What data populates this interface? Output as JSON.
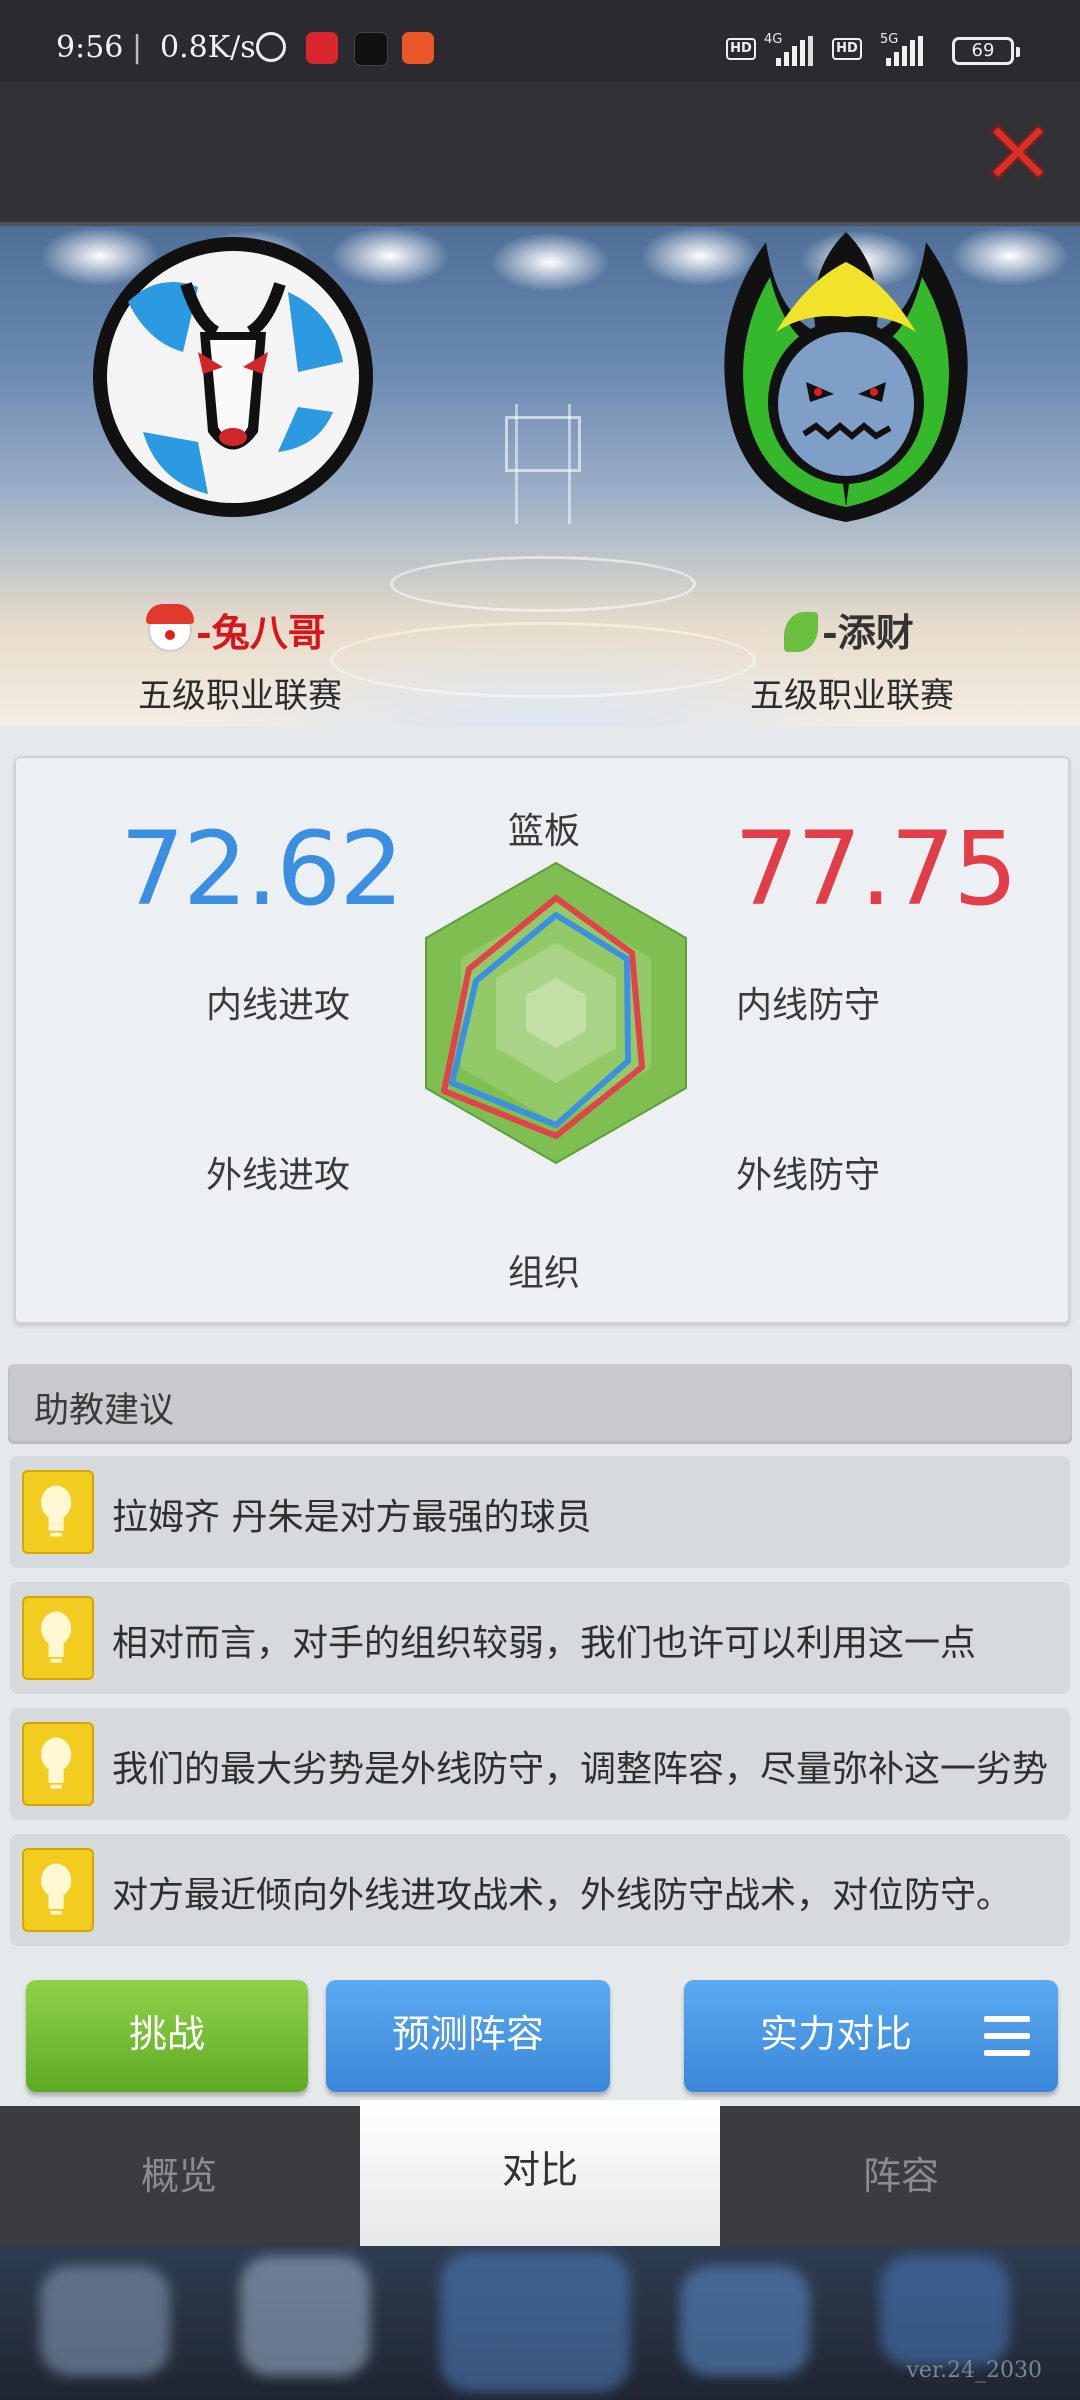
{
  "status_bar": {
    "time": "9:56",
    "separator": "|",
    "net_speed": "0.8K/s",
    "network_1": "4G",
    "network_2": "5G",
    "battery": "69"
  },
  "home_team": {
    "name": "-兔八哥",
    "league": "五级职业联赛",
    "score": "72.62",
    "color": "#3b8fe0"
  },
  "away_team": {
    "name": "-添财",
    "league": "五级职业联赛",
    "score": "77.75",
    "color": "#e23e49"
  },
  "radar": {
    "axes": [
      "篮板",
      "内线防守",
      "外线防守",
      "组织",
      "外线进攻",
      "内线进攻"
    ]
  },
  "advice": {
    "title": "助教建议",
    "items": [
      "拉姆齐 丹朱是对方最强的球员",
      "相对而言，对手的组织较弱，我们也许可以利用这一点",
      "我们的最大劣势是外线防守，调整阵容，尽量弥补这一劣势",
      "对方最近倾向外线进攻战术，外线防守战术，对位防守。"
    ]
  },
  "buttons": {
    "challenge": "挑战",
    "predict_lineup": "预测阵容",
    "strength_compare": "实力对比"
  },
  "tabs": [
    "概览",
    "对比",
    "阵容"
  ],
  "active_tab": "对比",
  "version": "ver.24_2030"
}
